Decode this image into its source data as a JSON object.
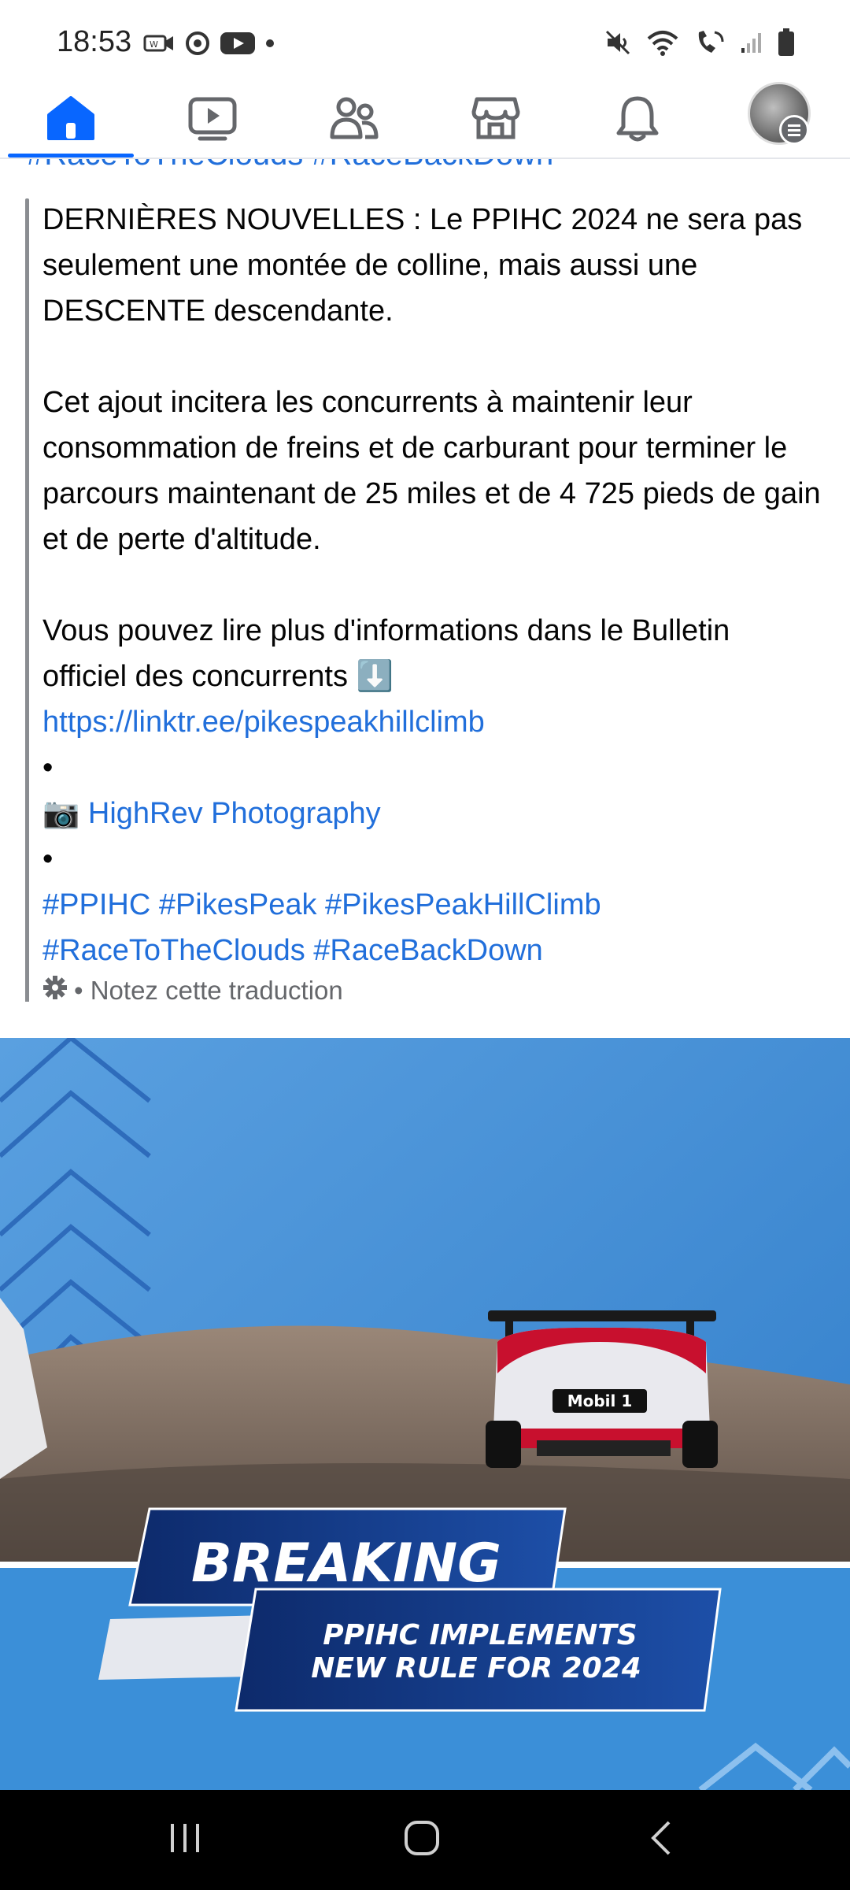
{
  "status_bar": {
    "time": "18:53",
    "left_icons": [
      "wifi-calling-icon",
      "sync-icon",
      "youtube-icon",
      "dot-icon"
    ],
    "right_icons": [
      "mute-icon",
      "wifi-icon",
      "call-icon",
      "signal-icon",
      "battery-icon"
    ]
  },
  "tab_bar": {
    "tabs": [
      {
        "icon": "home-icon",
        "active": true
      },
      {
        "icon": "video-icon",
        "active": false
      },
      {
        "icon": "friends-icon",
        "active": false
      },
      {
        "icon": "marketplace-icon",
        "active": false
      },
      {
        "icon": "bell-icon",
        "active": false
      },
      {
        "icon": "profile-avatar",
        "active": false
      }
    ],
    "accent": "#0866ff"
  },
  "post": {
    "cut_hashtags": "#RaceToTheClouds #RaceBackDown",
    "para1": "DERNIÈRES NOUVELLES : Le PPIHC 2024 ne sera pas seulement une montée de colline, mais aussi une DESCENTE descendante.",
    "para2": "Cet ajout incitera les concurrents à maintenir leur consommation de freins et de carburant pour terminer le parcours maintenant de 25 miles et de 4 725 pieds de gain et de perte d'altitude.",
    "para3": "Vous pouvez lire plus d'informations dans le Bulletin officiel des concurrents ⬇️",
    "link": "https://linktr.ee/pikespeakhillclimb",
    "bullet1": "•",
    "camera_emoji": "📷",
    "photo_credit": "HighRev Photography",
    "bullet2": "•",
    "hashtags_line1": "#PPIHC #PikesPeak #PikesPeakHillClimb",
    "hashtags_line2": "#RaceToTheClouds #RaceBackDown",
    "translate_note": "• Notez cette traduction",
    "link_color": "#216fdb"
  },
  "image": {
    "headline": "BREAKING",
    "subheadline_line1": "PPIHC IMPLEMENTS",
    "subheadline_line2": "NEW RULE FOR 2024",
    "car_sponsor": "Mobil 1"
  },
  "nav_bar": {
    "buttons": [
      "recents-icon",
      "home-button-icon",
      "back-icon"
    ]
  }
}
